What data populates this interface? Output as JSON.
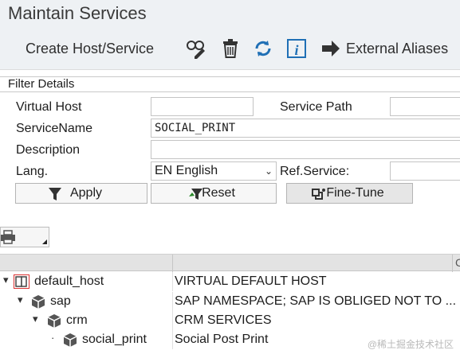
{
  "window": {
    "title": "Maintain Services"
  },
  "toolbar": {
    "create_label": "Create Host/Service",
    "icons": [
      "glasses-pencil-icon",
      "trash-icon",
      "refresh-icon",
      "info-icon"
    ],
    "aliases_label": "External Aliases"
  },
  "filter": {
    "title": "Filter Details",
    "virtual_host": {
      "label": "Virtual Host",
      "value": ""
    },
    "service_path": {
      "label": "Service Path",
      "value": ""
    },
    "service_name": {
      "label": "ServiceName",
      "value": "SOCIAL_PRINT"
    },
    "description": {
      "label": "Description",
      "value": ""
    },
    "lang": {
      "label": "Lang.",
      "value": "EN English"
    },
    "ref_service": {
      "label": "Ref.Service:",
      "value": ""
    },
    "apply_label": "Apply",
    "reset_label": "Reset",
    "finetune_label": "Fine-Tune"
  },
  "grid": {
    "col_c": "C",
    "rows": [
      {
        "name": "default_host",
        "desc": "VIRTUAL DEFAULT HOST",
        "expander": "▾"
      },
      {
        "name": "sap",
        "desc": "SAP NAMESPACE; SAP IS OBLIGED NOT TO ...",
        "expander": "▾"
      },
      {
        "name": "crm",
        "desc": "CRM SERVICES",
        "expander": "▾"
      },
      {
        "name": "social_print",
        "desc": "Social Post Print",
        "expander": "·"
      }
    ]
  },
  "watermark": "@稀土掘金技术社区",
  "colors": {
    "toolbar_bg": "#eef1f4",
    "accent_blue": "#1f6fb5",
    "grid_header_bg": "#e3e3e3"
  }
}
